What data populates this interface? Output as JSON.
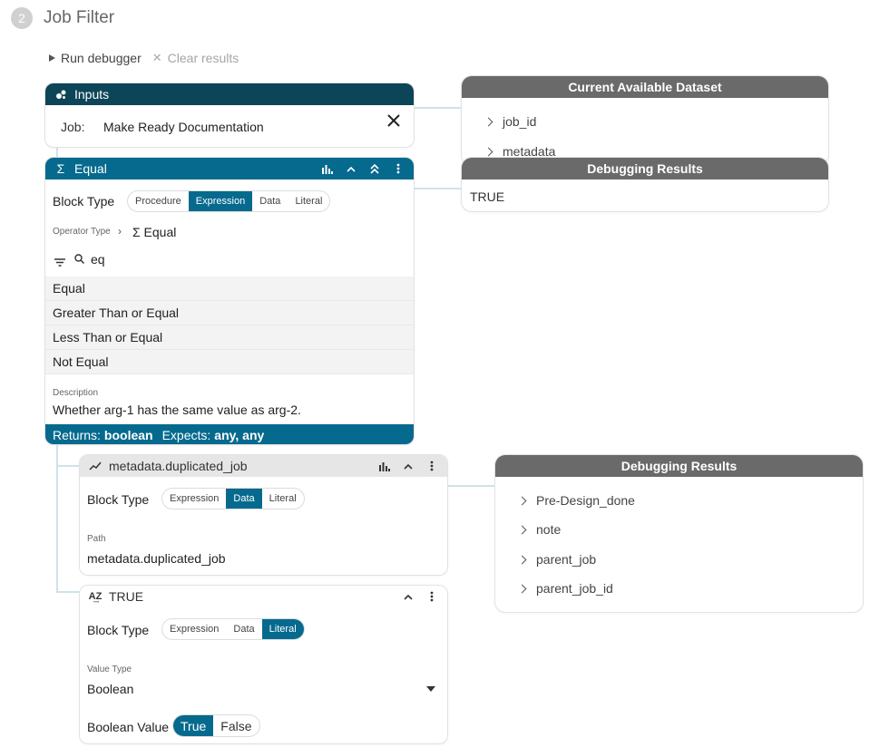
{
  "header": {
    "step": "2",
    "title": "Job Filter"
  },
  "toolbar": {
    "run_label": "Run debugger",
    "clear_label": "Clear results"
  },
  "inputs_card": {
    "title": "Inputs",
    "job_label": "Job:",
    "job_value": "Make Ready Documentation"
  },
  "dataset_panel": {
    "title": "Current Available Dataset",
    "items": [
      "job_id",
      "metadata"
    ]
  },
  "debug_panel_1": {
    "title": "Debugging Results",
    "value": "TRUE"
  },
  "equal_card": {
    "title": "Equal",
    "block_type_label": "Block Type",
    "block_types": [
      "Procedure",
      "Expression",
      "Data",
      "Literal"
    ],
    "selected_block_type": "Expression",
    "operator_type_label": "Operator Type",
    "operator_value": "Σ Equal",
    "search_value": "eq",
    "options": [
      "Equal",
      "Greater Than or Equal",
      "Less Than or Equal",
      "Not Equal"
    ],
    "description_label": "Description",
    "description": "Whether arg-1 has the same value as arg-2.",
    "returns_label": "Returns:",
    "returns_value": "boolean",
    "expects_label": "Expects:",
    "expects_value": "any, any"
  },
  "data_card": {
    "title": "metadata.duplicated_job",
    "block_type_label": "Block Type",
    "block_types": [
      "Expression",
      "Data",
      "Literal"
    ],
    "selected_block_type": "Data",
    "path_label": "Path",
    "path_value": "metadata.duplicated_job"
  },
  "debug_panel_2": {
    "title": "Debugging Results",
    "items": [
      "Pre-Design_done",
      "note",
      "parent_job",
      "parent_job_id"
    ]
  },
  "literal_card": {
    "title": "TRUE",
    "block_type_label": "Block Type",
    "block_types": [
      "Expression",
      "Data",
      "Literal"
    ],
    "selected_block_type": "Literal",
    "value_type_label": "Value Type",
    "value_type": "Boolean",
    "bool_label": "Boolean Value",
    "bool_options": [
      "True",
      "False"
    ],
    "bool_selected": "True"
  },
  "colors": {
    "dark_teal": "#0c4558",
    "accent_blue": "#066a8e",
    "panel_grey": "#6a6a6a"
  }
}
